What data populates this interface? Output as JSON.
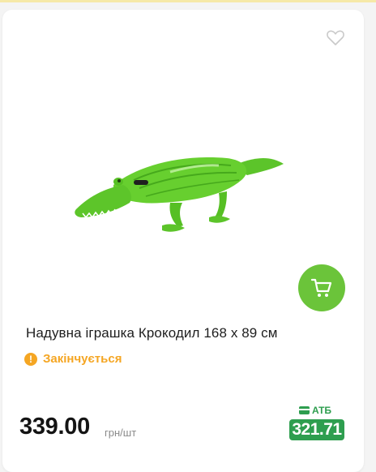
{
  "product": {
    "title": "Надувна іграшка Крокодил 168 х 89 см",
    "stock_status": "Закінчується",
    "price": "339.00",
    "unit": "грн/шт",
    "loyalty": {
      "label": "АТБ",
      "price": "321.71"
    }
  },
  "icons": {
    "favorite": "heart-outline-icon",
    "cart": "shopping-cart-icon",
    "stock": "exclamation-icon",
    "loyalty": "card-icon"
  },
  "colors": {
    "accent": "#6bc43a",
    "warning": "#f5a623",
    "loyalty": "#2e9e4f",
    "text": "#1e1e1e"
  }
}
